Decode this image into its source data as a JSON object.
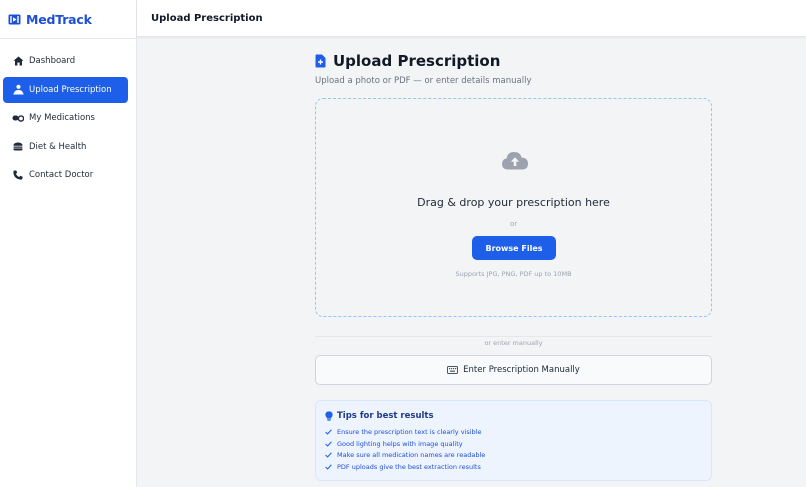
{
  "app": {
    "name": "MedTrack"
  },
  "sidebar": {
    "items": [
      {
        "label": "Dashboard",
        "icon": "home-icon",
        "active": false
      },
      {
        "label": "Upload Prescription",
        "icon": "user-upload-icon",
        "active": true
      },
      {
        "label": "My Medications",
        "icon": "pills-icon",
        "active": false
      },
      {
        "label": "Diet & Health",
        "icon": "burger-icon",
        "active": false
      },
      {
        "label": "Contact Doctor",
        "icon": "phone-icon",
        "active": false
      }
    ]
  },
  "header": {
    "title": "Upload Prescription"
  },
  "page": {
    "title": "Upload Prescription",
    "subtitle": "Upload a photo or PDF — or enter details manually"
  },
  "dropzone": {
    "title": "Drag & drop your prescription here",
    "or_text": "or",
    "browse_label": "Browse Files",
    "hint": "Supports JPG, PNG, PDF up to 10MB"
  },
  "divider": {
    "text": "or enter manually"
  },
  "manual": {
    "label": "Enter Prescription Manually"
  },
  "tips": {
    "title": "Tips for best results",
    "items": [
      "Ensure the prescription text is clearly visible",
      "Good lighting helps with image quality",
      "Make sure all medication names are readable",
      "PDF uploads give the best extraction results"
    ]
  },
  "colors": {
    "primary": "#1d5fe8",
    "brand": "#1d4ed8",
    "dropzone_border": "#93c5fd",
    "tips_bg": "#eef4fe"
  }
}
